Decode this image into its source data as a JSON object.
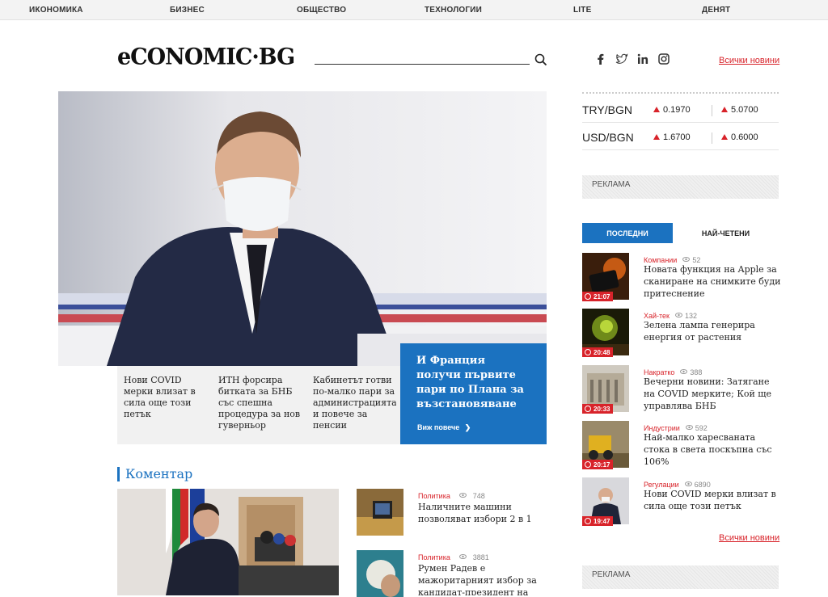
{
  "topnav": [
    "ИКОНОМИКА",
    "БИЗНЕС",
    "ОБЩЕСТВО",
    "ТЕХНОЛОГИИ",
    "LITE",
    "ДЕНЯТ"
  ],
  "logo": "eCONOMIC·BG",
  "header": {
    "all_news": "Всички новини"
  },
  "social_icons": [
    "facebook-icon",
    "twitter-icon",
    "linkedin-icon",
    "instagram-icon"
  ],
  "hero": {
    "title": "И Франция получи първите пари по Плана за възстановяване",
    "more": "Виж повече"
  },
  "strip": [
    "Нови COVID мерки влизат в сила още този петък",
    "ИТН форсира битката за БНБ със спешна процедура за нов гуверньор",
    "Кабинетът готви по-малко пари за администрацията и повече за пенсии"
  ],
  "comment": {
    "heading": "Коментар",
    "news": [
      {
        "category": "Политика",
        "views": "748",
        "title": "Наличните машини позволяват избори 2 в 1"
      },
      {
        "category": "Политика",
        "views": "3881",
        "title": "Румен Радев е мажоритарният избор за кандидат-президент на"
      }
    ]
  },
  "rates": [
    {
      "pair": "TRY/BGN",
      "v1": "0.1970",
      "v2": "5.0700"
    },
    {
      "pair": "USD/BGN",
      "v1": "1.6700",
      "v2": "0.6000"
    }
  ],
  "ad_label": "РЕКЛАМА",
  "tabs": {
    "latest": "ПОСЛЕДНИ",
    "most_read": "НАЙ-ЧЕТЕНИ"
  },
  "sidebar_news": [
    {
      "category": "Компании",
      "views": "52",
      "time": "21:07",
      "title": "Новата функция на Apple за сканиране на снимките буди притеснение"
    },
    {
      "category": "Хай-тек",
      "views": "132",
      "time": "20:48",
      "title": "Зелена лампа генерира енергия от растения"
    },
    {
      "category": "Накратко",
      "views": "388",
      "time": "20:33",
      "title": "Вечерни новини: Затягане на COVID мерките; Кой ще управлява БНБ"
    },
    {
      "category": "Индустрии",
      "views": "592",
      "time": "20:17",
      "title": "Най-малко харесваната стока в света поскъпна със 106%"
    },
    {
      "category": "Регулации",
      "views": "6890",
      "time": "19:47",
      "title": "Нови COVID мерки влизат в сила още този петък"
    }
  ],
  "sidebar_all_news": "Всички новини",
  "colors": {
    "accent": "#1b72c0",
    "red": "#d8232a"
  }
}
